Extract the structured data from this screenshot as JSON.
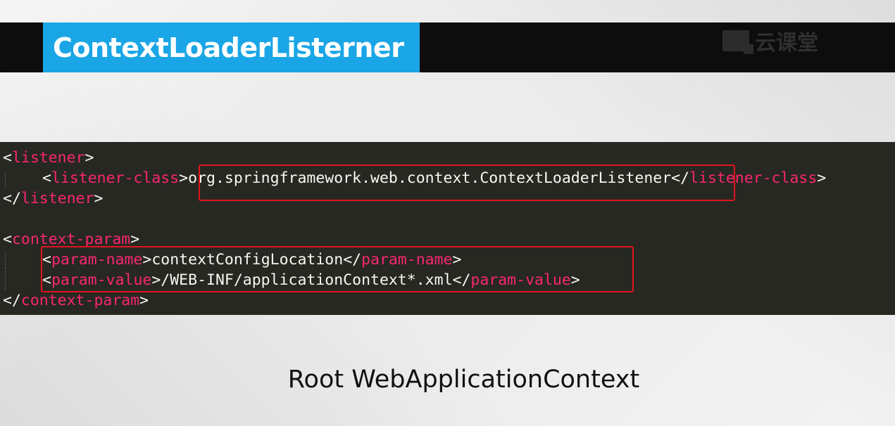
{
  "slide": {
    "title": "ContextLoaderListerner",
    "watermark": "云课堂",
    "caption": "Root WebApplicationContext"
  },
  "code": {
    "line1": {
      "open": "<",
      "tag": "listener",
      "close": ">"
    },
    "line2": {
      "open": "<",
      "tag": "listener-class",
      "close": ">",
      "text": "org.springframework.web.context.ContextLoaderListener",
      "end_open": "</",
      "end_tag": "listener-class",
      "end_close": ">"
    },
    "line3": {
      "open": "</",
      "tag": "listener",
      "close": ">"
    },
    "line4": {
      "open": "<",
      "tag": "context-param",
      "close": ">"
    },
    "line5": {
      "open": "<",
      "tag": "param-name",
      "close": ">",
      "text": "contextConfigLocation",
      "end_open": "</",
      "end_tag": "param-name",
      "end_close": ">"
    },
    "line6": {
      "open": "<",
      "tag": "param-value",
      "close": ">",
      "text": "/WEB-INF/applicationContext*.xml",
      "end_open": "</",
      "end_tag": "param-value",
      "end_close": ">"
    },
    "line7": {
      "open": "</",
      "tag": "context-param",
      "close": ">"
    }
  },
  "colors": {
    "code_background": "#272822",
    "tag_color": "#f92672",
    "text_color": "#f8f8f2",
    "title_background": "#1aa6e6",
    "highlight_border": "#e0141e"
  }
}
